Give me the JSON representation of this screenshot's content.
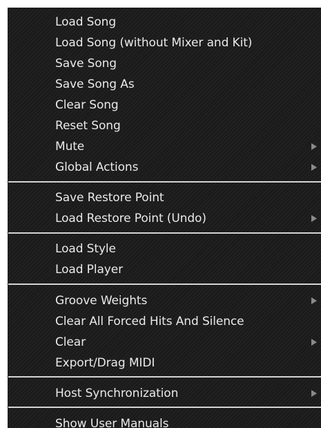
{
  "menu": {
    "items": [
      {
        "label": "Load Song",
        "submenu": false
      },
      {
        "label": "Load Song (without Mixer and Kit)",
        "submenu": false
      },
      {
        "label": "Save Song",
        "submenu": false
      },
      {
        "label": "Save Song As",
        "submenu": false
      },
      {
        "label": "Clear Song",
        "submenu": false
      },
      {
        "label": "Reset Song",
        "submenu": false
      },
      {
        "label": "Mute",
        "submenu": true
      },
      {
        "label": "Global Actions",
        "submenu": true
      },
      {
        "label": "Save Restore Point",
        "submenu": false
      },
      {
        "label": "Load Restore Point (Undo)",
        "submenu": true
      },
      {
        "label": "Load Style",
        "submenu": false
      },
      {
        "label": "Load Player",
        "submenu": false
      },
      {
        "label": "Groove Weights",
        "submenu": true
      },
      {
        "label": "Clear All Forced Hits And Silence",
        "submenu": false
      },
      {
        "label": "Clear",
        "submenu": true
      },
      {
        "label": "Export/Drag MIDI",
        "submenu": false
      },
      {
        "label": "Host Synchronization",
        "submenu": true
      },
      {
        "label": "Show User Manuals",
        "submenu": false
      }
    ],
    "submenu_icon": "submenu-arrow-icon",
    "colors": {
      "background": "#1b1b1b",
      "text": "#e9e9e9",
      "separator": "#d4d4d4",
      "arrow": "#8a8a8a"
    }
  }
}
